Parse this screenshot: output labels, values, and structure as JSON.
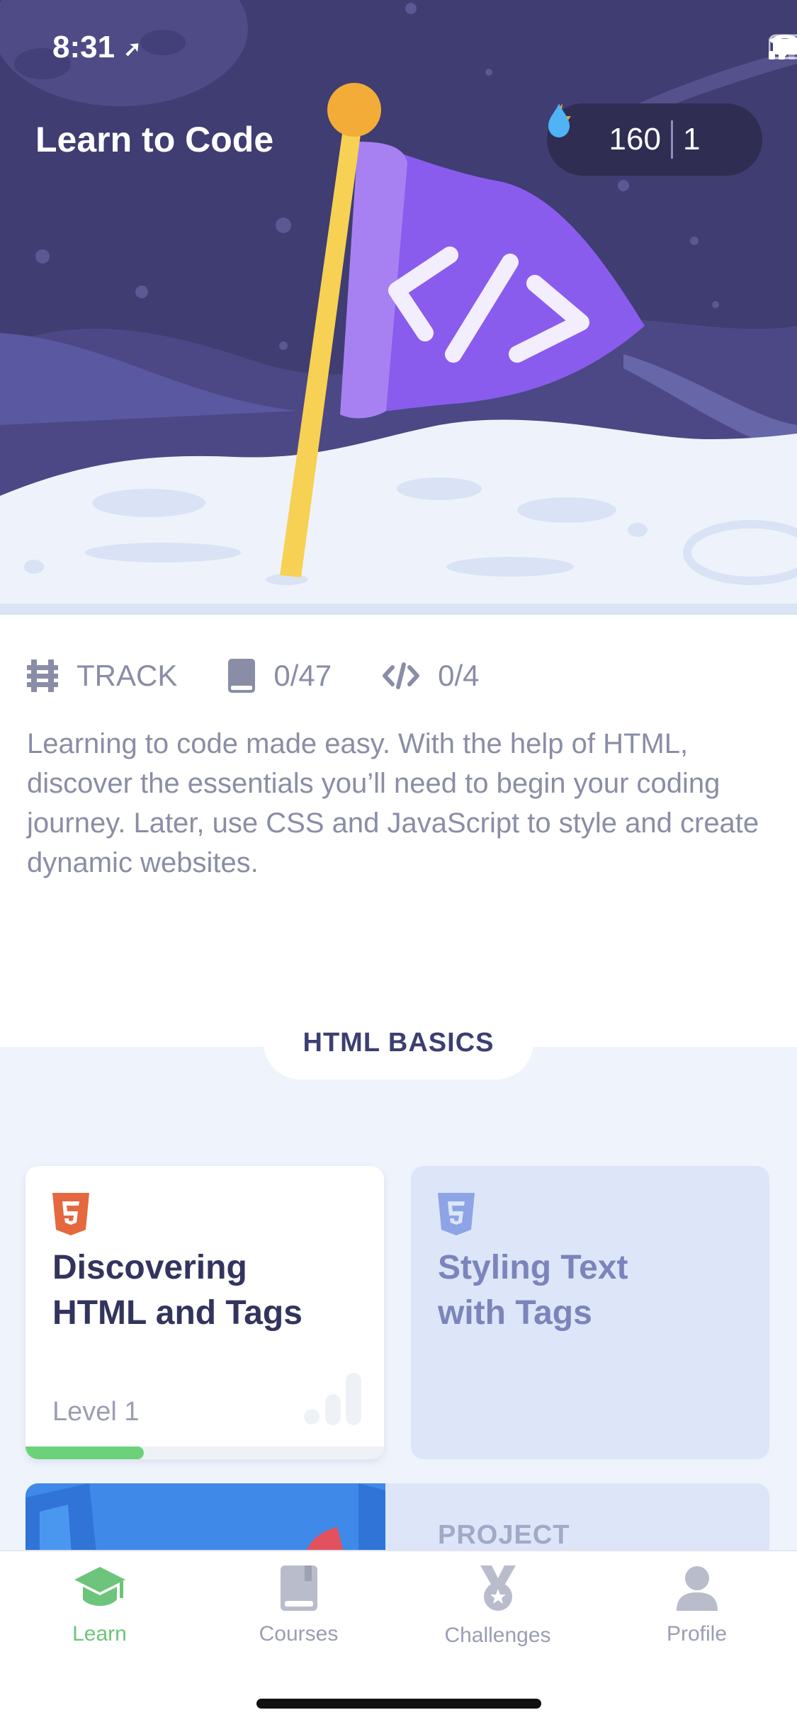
{
  "status_bar": {
    "time": "8:31"
  },
  "header": {
    "title": "Learn to Code",
    "bolts": "160",
    "streak": "1"
  },
  "meta": {
    "type": "TRACK",
    "lessons": "0/47",
    "projects": "0/4"
  },
  "description": "Learning to code made easy. With the help of HTML, discover the essentials you’ll need to begin your coding journey. Later, use CSS and JavaScript to style and create dynamic websites.",
  "section": {
    "title": "HTML BASICS"
  },
  "courses": [
    {
      "title_line1": "Discovering",
      "title_line2": "HTML and Tags",
      "level": "Level 1",
      "progress": 0.33
    },
    {
      "title_line1": "Styling Text",
      "title_line2": "with Tags"
    },
    {
      "label": "PROJECT"
    }
  ],
  "tabs": [
    {
      "label": "Learn",
      "icon": "graduation-cap-icon",
      "active": true
    },
    {
      "label": "Courses",
      "icon": "book-icon"
    },
    {
      "label": "Challenges",
      "icon": "medal-icon"
    },
    {
      "label": "Profile",
      "icon": "person-icon"
    }
  ],
  "colors": {
    "accent": "#6cc57a",
    "hero_bg": "#3f3d72",
    "flag": "#8b5cf0",
    "bolt": "#f5a623",
    "drop": "#4fb3f5"
  }
}
